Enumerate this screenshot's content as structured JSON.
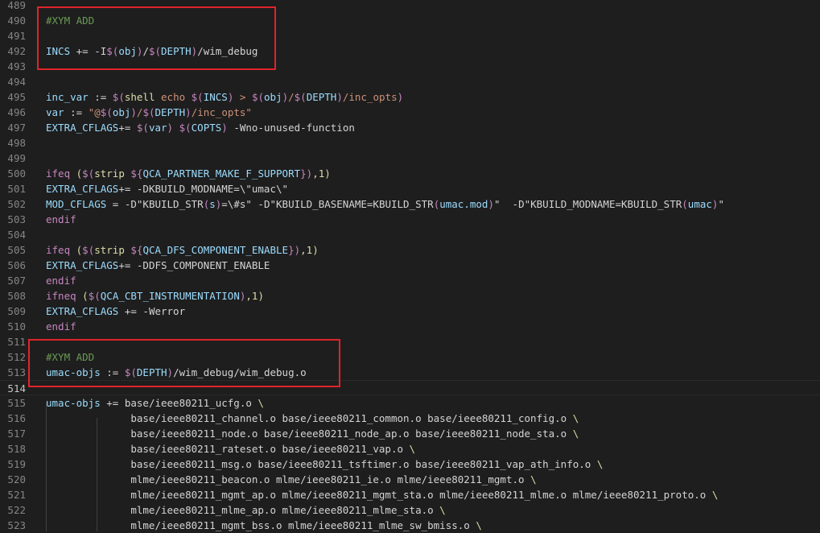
{
  "editor": {
    "lines": [
      {
        "num": "489",
        "tokens": []
      },
      {
        "num": "490",
        "tokens": [
          [
            "#XYM ADD",
            "comment"
          ]
        ]
      },
      {
        "num": "491",
        "tokens": []
      },
      {
        "num": "492",
        "tokens": [
          [
            "INCS",
            "var"
          ],
          [
            " += -I",
            "plain"
          ],
          [
            "$(",
            "kw"
          ],
          [
            "obj",
            "var"
          ],
          [
            ")",
            "kw"
          ],
          [
            "/",
            "plain"
          ],
          [
            "$(",
            "kw"
          ],
          [
            "DEPTH",
            "var"
          ],
          [
            ")",
            "kw"
          ],
          [
            "/wim_debug",
            "plain"
          ]
        ]
      },
      {
        "num": "493",
        "tokens": []
      },
      {
        "num": "494",
        "tokens": []
      },
      {
        "num": "495",
        "tokens": [
          [
            "inc_var",
            "var"
          ],
          [
            " := ",
            "plain"
          ],
          [
            "$(",
            "kw"
          ],
          [
            "shell",
            "fn"
          ],
          [
            " echo ",
            "str"
          ],
          [
            "$(",
            "kw"
          ],
          [
            "INCS",
            "var"
          ],
          [
            ")",
            "kw"
          ],
          [
            " > ",
            "str"
          ],
          [
            "$(",
            "kw"
          ],
          [
            "obj",
            "var"
          ],
          [
            ")",
            "kw"
          ],
          [
            "/",
            "str"
          ],
          [
            "$(",
            "kw"
          ],
          [
            "DEPTH",
            "var"
          ],
          [
            ")",
            "kw"
          ],
          [
            "/inc_opts",
            "str"
          ],
          [
            ")",
            "kw"
          ]
        ]
      },
      {
        "num": "496",
        "tokens": [
          [
            "var",
            "var"
          ],
          [
            " := ",
            "plain"
          ],
          [
            "\"@",
            "str"
          ],
          [
            "$(",
            "kw"
          ],
          [
            "obj",
            "var"
          ],
          [
            ")",
            "kw"
          ],
          [
            "/",
            "str"
          ],
          [
            "$(",
            "kw"
          ],
          [
            "DEPTH",
            "var"
          ],
          [
            ")",
            "kw"
          ],
          [
            "/inc_opts\"",
            "str"
          ]
        ]
      },
      {
        "num": "497",
        "tokens": [
          [
            "EXTRA_CFLAGS",
            "var"
          ],
          [
            "+= ",
            "plain"
          ],
          [
            "$(",
            "kw"
          ],
          [
            "var",
            "var"
          ],
          [
            ")",
            "kw"
          ],
          [
            " ",
            "plain"
          ],
          [
            "$(",
            "kw"
          ],
          [
            "COPTS",
            "var"
          ],
          [
            ")",
            "kw"
          ],
          [
            " -Wno-unused-function",
            "plain"
          ]
        ]
      },
      {
        "num": "498",
        "tokens": []
      },
      {
        "num": "499",
        "tokens": []
      },
      {
        "num": "500",
        "tokens": [
          [
            "ifeq",
            "kw"
          ],
          [
            " (",
            "fn"
          ],
          [
            "$(",
            "kw"
          ],
          [
            "strip",
            "fn"
          ],
          [
            " ",
            "plain"
          ],
          [
            "${",
            "kw"
          ],
          [
            "QCA_PARTNER_MAKE_F_SUPPORT",
            "var"
          ],
          [
            "}",
            "kw"
          ],
          [
            ")",
            "kw"
          ],
          [
            ",1)",
            "fn"
          ]
        ]
      },
      {
        "num": "501",
        "tokens": [
          [
            "EXTRA_CFLAGS",
            "var"
          ],
          [
            "+= -DKBUILD_MODNAME=\\\"umac\\\"",
            "plain"
          ]
        ]
      },
      {
        "num": "502",
        "tokens": [
          [
            "MOD_CFLAGS",
            "var"
          ],
          [
            " = -D\"KBUILD_STR",
            "plain"
          ],
          [
            "(",
            "kw"
          ],
          [
            "s",
            "var"
          ],
          [
            ")",
            "kw"
          ],
          [
            "=\\#s\" -D\"KBUILD_BASENAME=KBUILD_STR",
            "plain"
          ],
          [
            "(",
            "kw"
          ],
          [
            "umac.mod",
            "var"
          ],
          [
            ")",
            "kw"
          ],
          [
            "\"  -D\"KBUILD_MODNAME=KBUILD_STR",
            "plain"
          ],
          [
            "(",
            "kw"
          ],
          [
            "umac",
            "var"
          ],
          [
            ")",
            "kw"
          ],
          [
            "\"",
            "plain"
          ]
        ]
      },
      {
        "num": "503",
        "tokens": [
          [
            "endif",
            "kw"
          ]
        ]
      },
      {
        "num": "504",
        "tokens": []
      },
      {
        "num": "505",
        "tokens": [
          [
            "ifeq",
            "kw"
          ],
          [
            " (",
            "fn"
          ],
          [
            "$(",
            "kw"
          ],
          [
            "strip",
            "fn"
          ],
          [
            " ",
            "plain"
          ],
          [
            "${",
            "kw"
          ],
          [
            "QCA_DFS_COMPONENT_ENABLE",
            "var"
          ],
          [
            "}",
            "kw"
          ],
          [
            ")",
            "kw"
          ],
          [
            ",1)",
            "fn"
          ]
        ]
      },
      {
        "num": "506",
        "tokens": [
          [
            "EXTRA_CFLAGS",
            "var"
          ],
          [
            "+= -DDFS_COMPONENT_ENABLE",
            "plain"
          ]
        ]
      },
      {
        "num": "507",
        "tokens": [
          [
            "endif",
            "kw"
          ]
        ]
      },
      {
        "num": "508",
        "tokens": [
          [
            "ifneq",
            "kw"
          ],
          [
            " (",
            "fn"
          ],
          [
            "$(",
            "kw"
          ],
          [
            "QCA_CBT_INSTRUMENTATION",
            "var"
          ],
          [
            ")",
            "kw"
          ],
          [
            ",1)",
            "fn"
          ]
        ]
      },
      {
        "num": "509",
        "tokens": [
          [
            "EXTRA_CFLAGS",
            "var"
          ],
          [
            " += -Werror",
            "plain"
          ]
        ]
      },
      {
        "num": "510",
        "tokens": [
          [
            "endif",
            "kw"
          ]
        ]
      },
      {
        "num": "511",
        "tokens": []
      },
      {
        "num": "512",
        "tokens": [
          [
            "#XYM ADD",
            "comment"
          ]
        ]
      },
      {
        "num": "513",
        "tokens": [
          [
            "umac-objs",
            "var"
          ],
          [
            " := ",
            "plain"
          ],
          [
            "$(",
            "kw"
          ],
          [
            "DEPTH",
            "var"
          ],
          [
            ")",
            "kw"
          ],
          [
            "/wim_debug/wim_debug.o",
            "plain"
          ]
        ]
      },
      {
        "num": "514",
        "tokens": []
      },
      {
        "num": "515",
        "tokens": [
          [
            "umac-objs",
            "var"
          ],
          [
            " += base/ieee80211_ucfg.o ",
            "plain"
          ],
          [
            "\\",
            "fn"
          ]
        ]
      },
      {
        "num": "516",
        "tokens": [
          [
            "              base/ieee80211_channel.o base/ieee80211_common.o base/ieee80211_config.o ",
            "plain"
          ],
          [
            "\\",
            "fn"
          ]
        ]
      },
      {
        "num": "517",
        "tokens": [
          [
            "              base/ieee80211_node.o base/ieee80211_node_ap.o base/ieee80211_node_sta.o ",
            "plain"
          ],
          [
            "\\",
            "fn"
          ]
        ]
      },
      {
        "num": "518",
        "tokens": [
          [
            "              base/ieee80211_rateset.o base/ieee80211_vap.o ",
            "plain"
          ],
          [
            "\\",
            "fn"
          ]
        ]
      },
      {
        "num": "519",
        "tokens": [
          [
            "              base/ieee80211_msg.o base/ieee80211_tsftimer.o base/ieee80211_vap_ath_info.o ",
            "plain"
          ],
          [
            "\\",
            "fn"
          ]
        ]
      },
      {
        "num": "520",
        "tokens": [
          [
            "              mlme/ieee80211_beacon.o mlme/ieee80211_ie.o mlme/ieee80211_mgmt.o ",
            "plain"
          ],
          [
            "\\",
            "fn"
          ]
        ]
      },
      {
        "num": "521",
        "tokens": [
          [
            "              mlme/ieee80211_mgmt_ap.o mlme/ieee80211_mgmt_sta.o mlme/ieee80211_mlme.o mlme/ieee80211_proto.o ",
            "plain"
          ],
          [
            "\\",
            "fn"
          ]
        ]
      },
      {
        "num": "522",
        "tokens": [
          [
            "              mlme/ieee80211_mlme_ap.o mlme/ieee80211_mlme_sta.o ",
            "plain"
          ],
          [
            "\\",
            "fn"
          ]
        ]
      },
      {
        "num": "523",
        "tokens": [
          [
            "              mlme/ieee80211_mgmt_bss.o mlme/ieee80211_mlme_sw_bmiss.o ",
            "plain"
          ],
          [
            "\\",
            "fn"
          ]
        ]
      }
    ],
    "current_line": "514",
    "colors": {
      "background": "#1e1e1e",
      "variable": "#9cdcfe",
      "comment": "#6a9955",
      "keyword": "#c586c0",
      "function": "#dcdcaa",
      "string": "#ce9178",
      "highlight_box": "#e0242a"
    }
  }
}
